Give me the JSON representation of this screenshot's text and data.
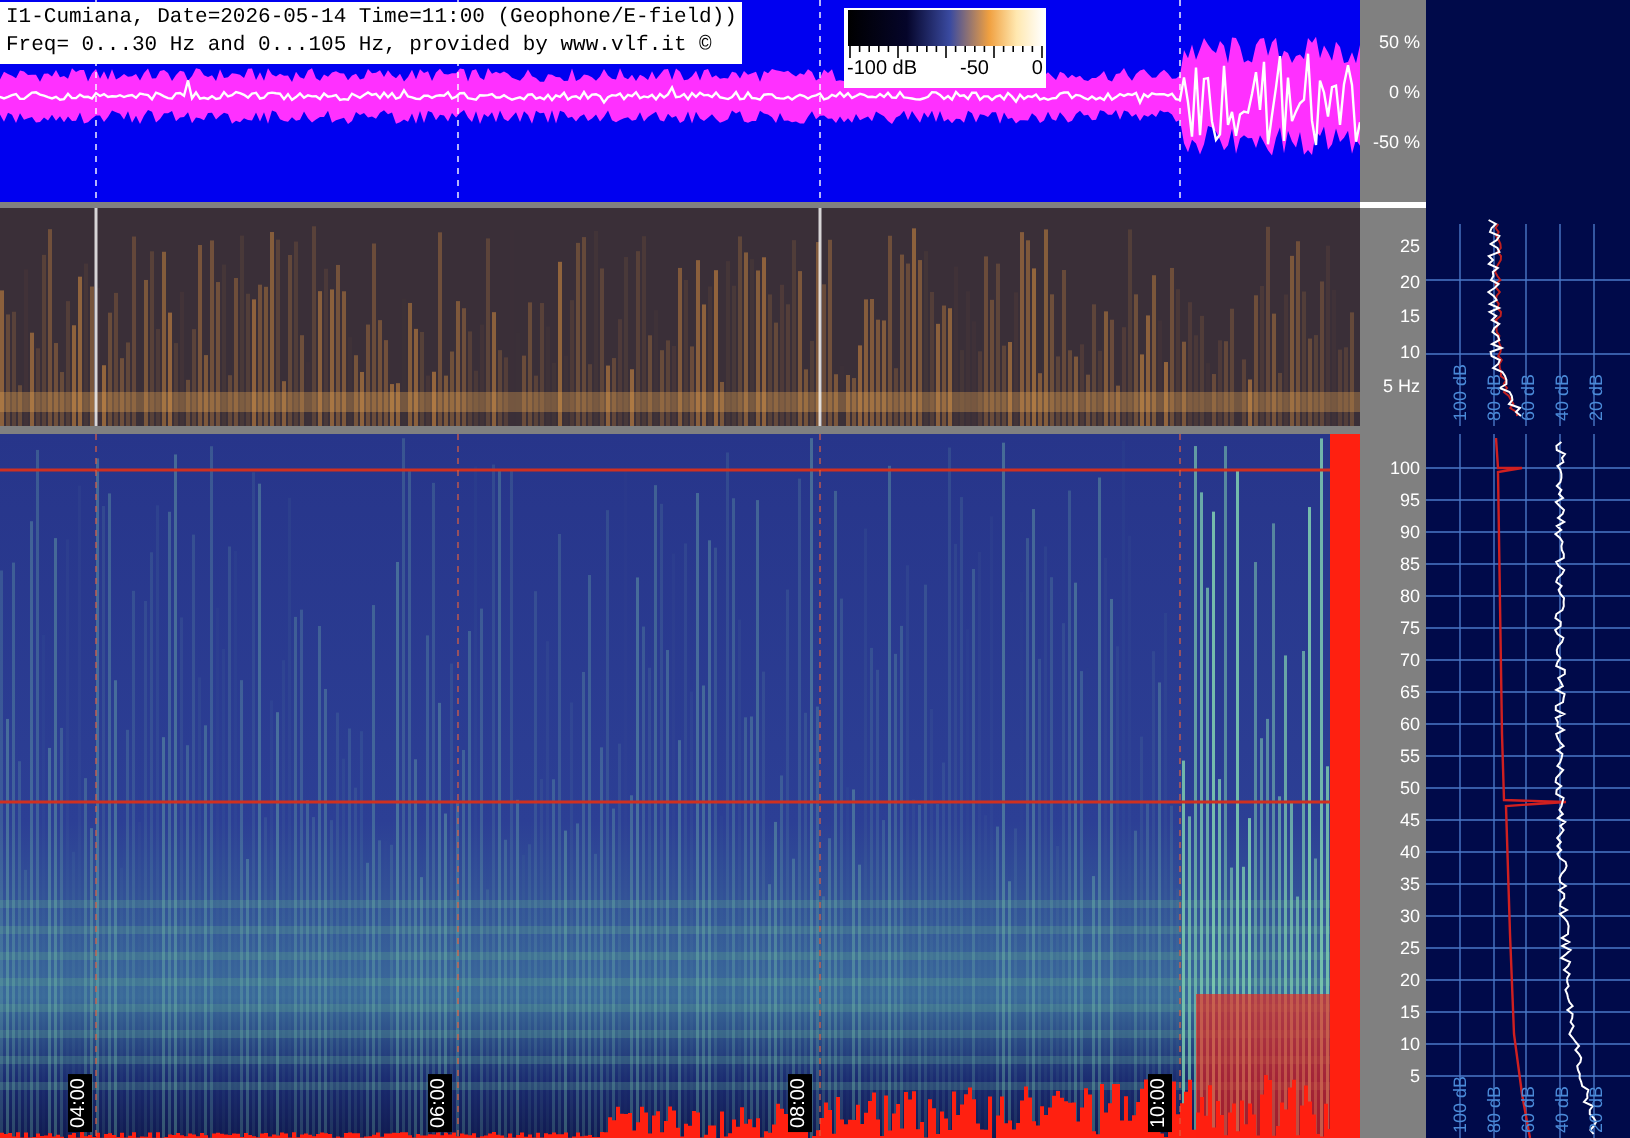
{
  "header": {
    "line_1": "I1-Cumiana, Date=2026-05-14 Time=11:00 (Geophone/E-field))",
    "line_2": "Freq= 0...30 Hz and 0...105 Hz, provided by www.vlf.it ©"
  },
  "colorbar": {
    "labels": [
      "-100 dB",
      "-50",
      "0"
    ]
  },
  "waveform_axis": {
    "labels": [
      "50 %",
      "0 %",
      "-50 %"
    ]
  },
  "low_band_axis": {
    "labels": [
      "25",
      "20",
      "15",
      "10",
      "5 Hz"
    ]
  },
  "high_band_axis": {
    "labels": [
      "100",
      "95",
      "90",
      "85",
      "80",
      "75",
      "70",
      "65",
      "60",
      "55",
      "50",
      "45",
      "40",
      "35",
      "30",
      "25",
      "20",
      "15",
      "10",
      "5"
    ]
  },
  "time_labels": [
    "04:00",
    "06:00",
    "08:00",
    "10:00"
  ],
  "low_spectrum_scale": [
    "100 dB",
    "80 dB",
    "60 dB",
    "40 dB",
    "20 dB"
  ],
  "high_spectrum_scale": [
    "100 dB",
    "80 dB",
    "60 dB",
    "40 dB",
    "20 dB"
  ]
}
